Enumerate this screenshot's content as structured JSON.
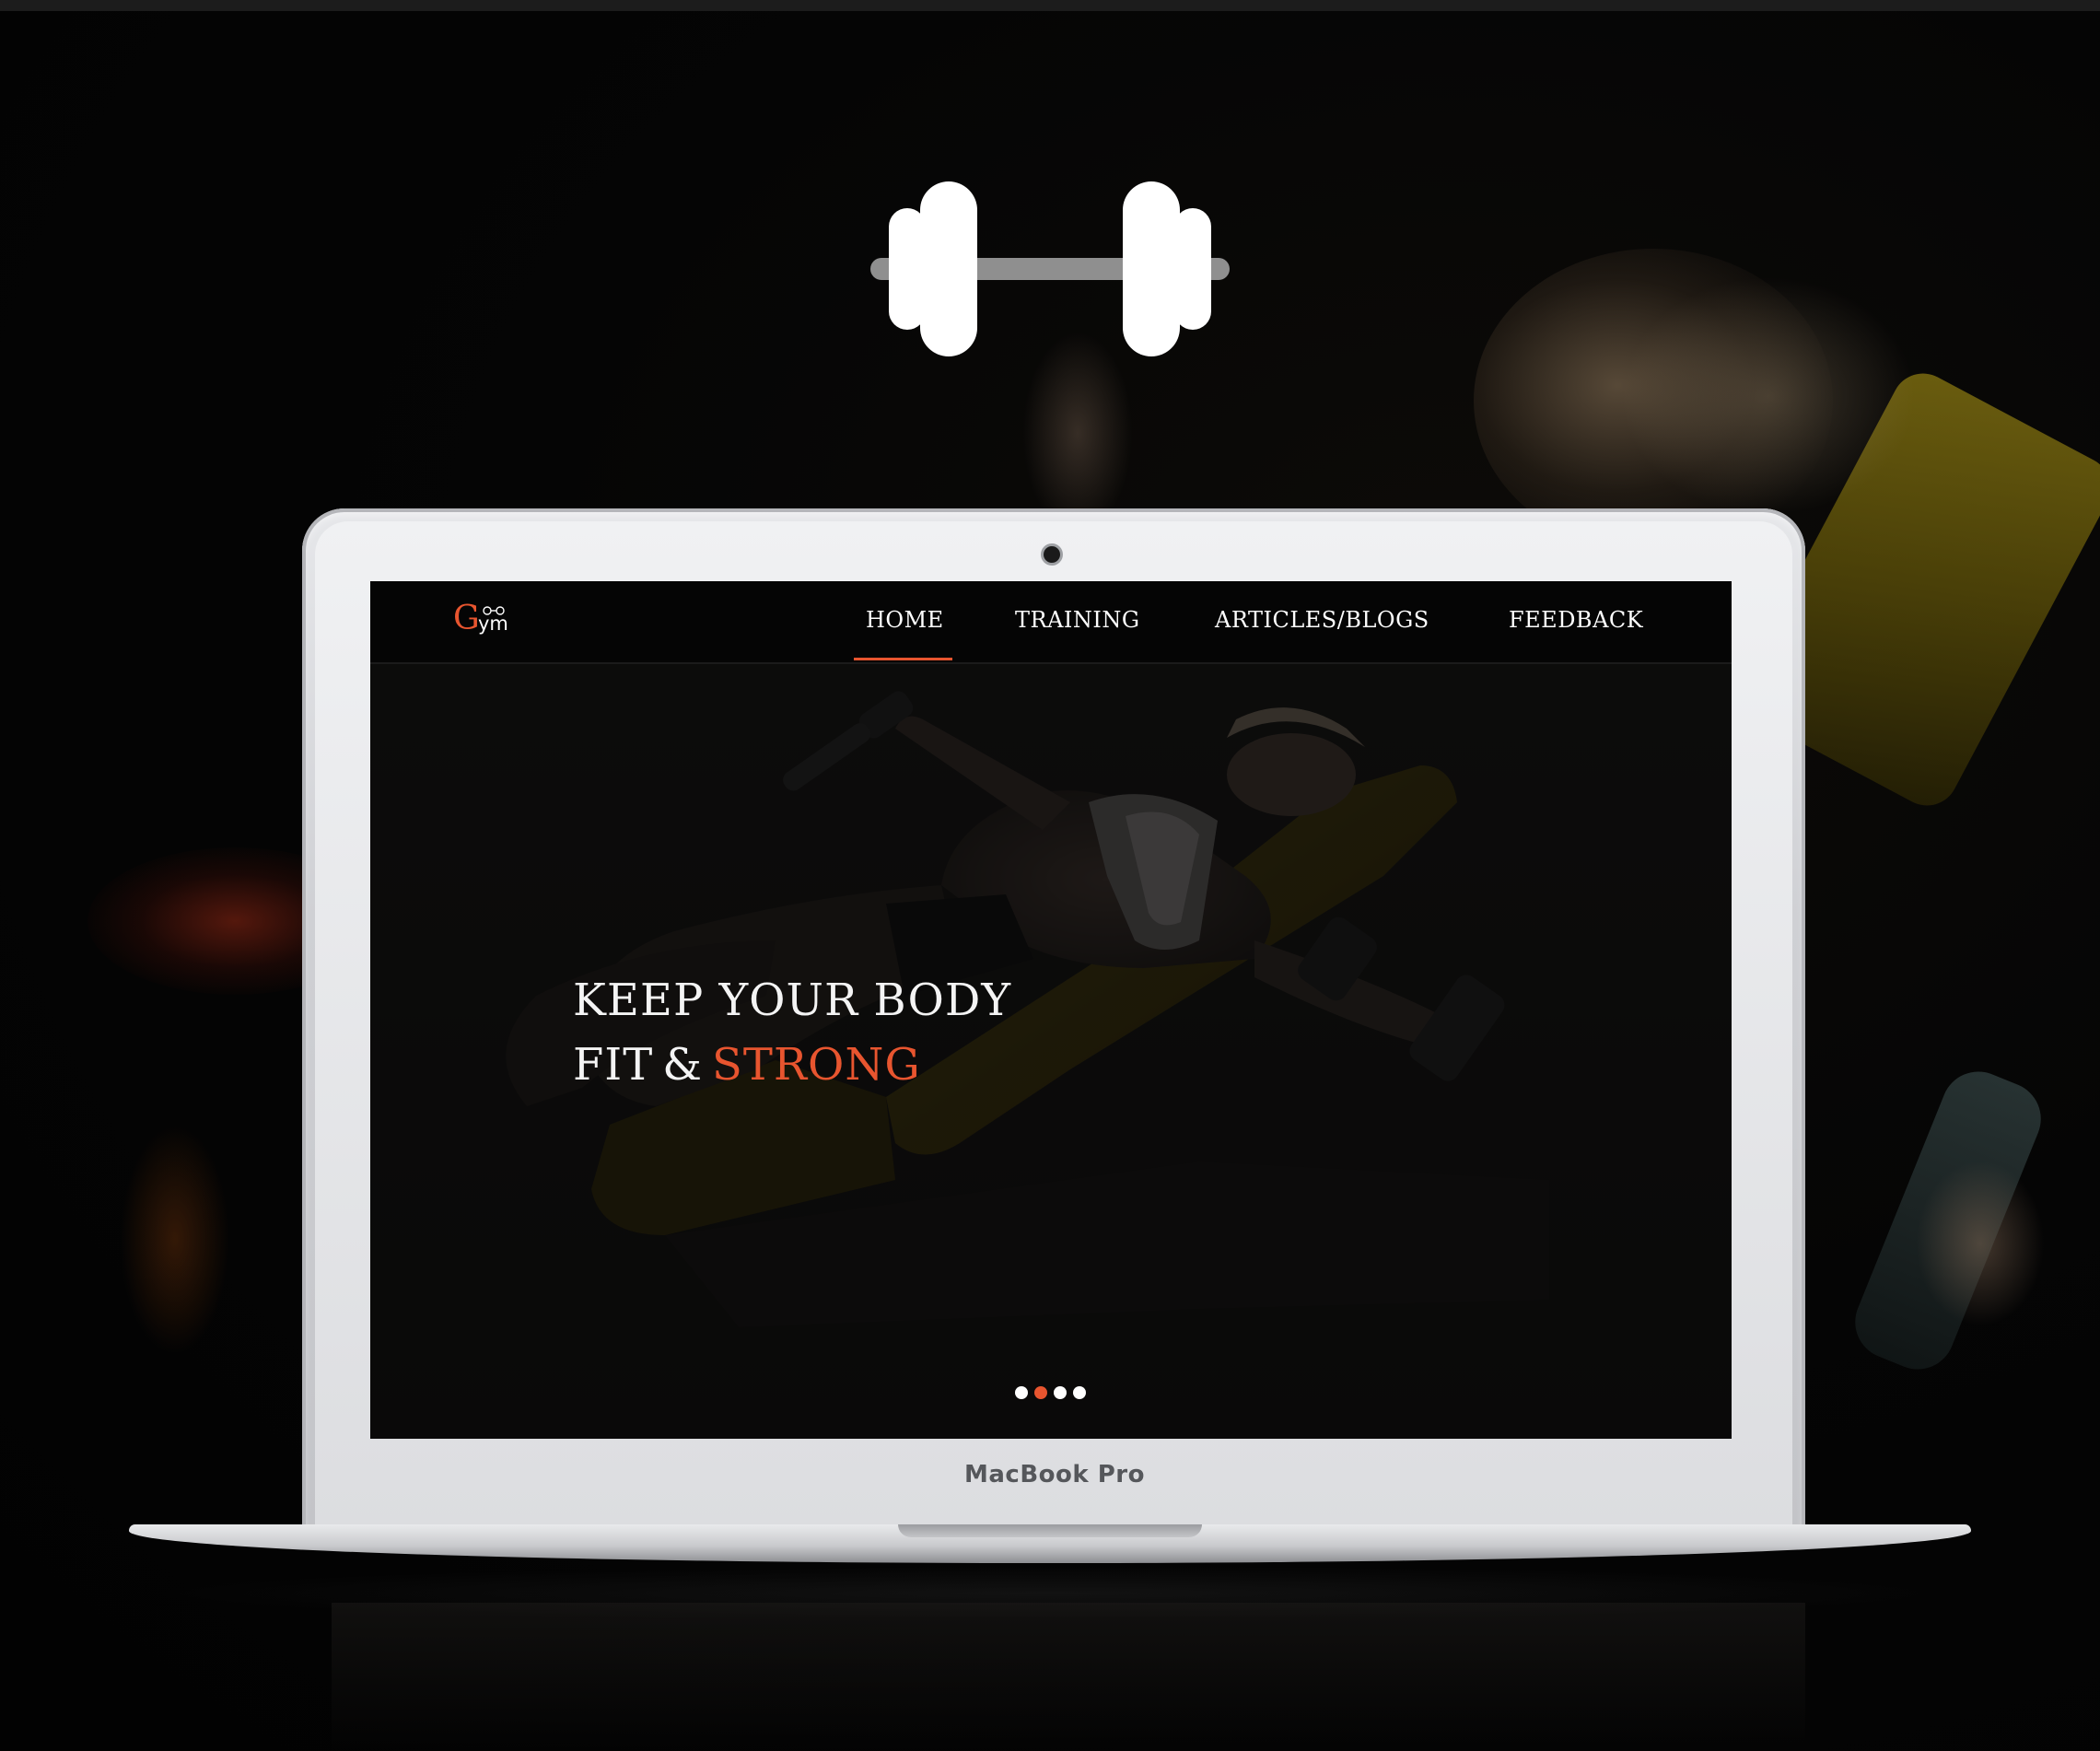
{
  "site": {
    "logo": {
      "letter": "G",
      "rest": "ym"
    },
    "nav": [
      {
        "label": "HOME",
        "active": true
      },
      {
        "label": "TRAINING",
        "active": false
      },
      {
        "label": "ARTICLES/BLOGS",
        "active": false
      },
      {
        "label": "FEEDBACK",
        "active": false
      }
    ],
    "hero": {
      "line1": "KEEP YOUR BODY",
      "line2_a": "FIT",
      "line2_amp": "&",
      "line2_accent": "STRONG"
    },
    "carousel": {
      "slide_count": 4,
      "active_index": 1
    }
  },
  "device": {
    "label": "MacBook Pro"
  },
  "colors": {
    "accent": "#e8552f",
    "background": "#020202",
    "nav_background": "#050505",
    "text": "#ffffff"
  },
  "icons": {
    "hero_logo": "dumbbell-icon",
    "site_logo": "dumbbell-icon"
  }
}
